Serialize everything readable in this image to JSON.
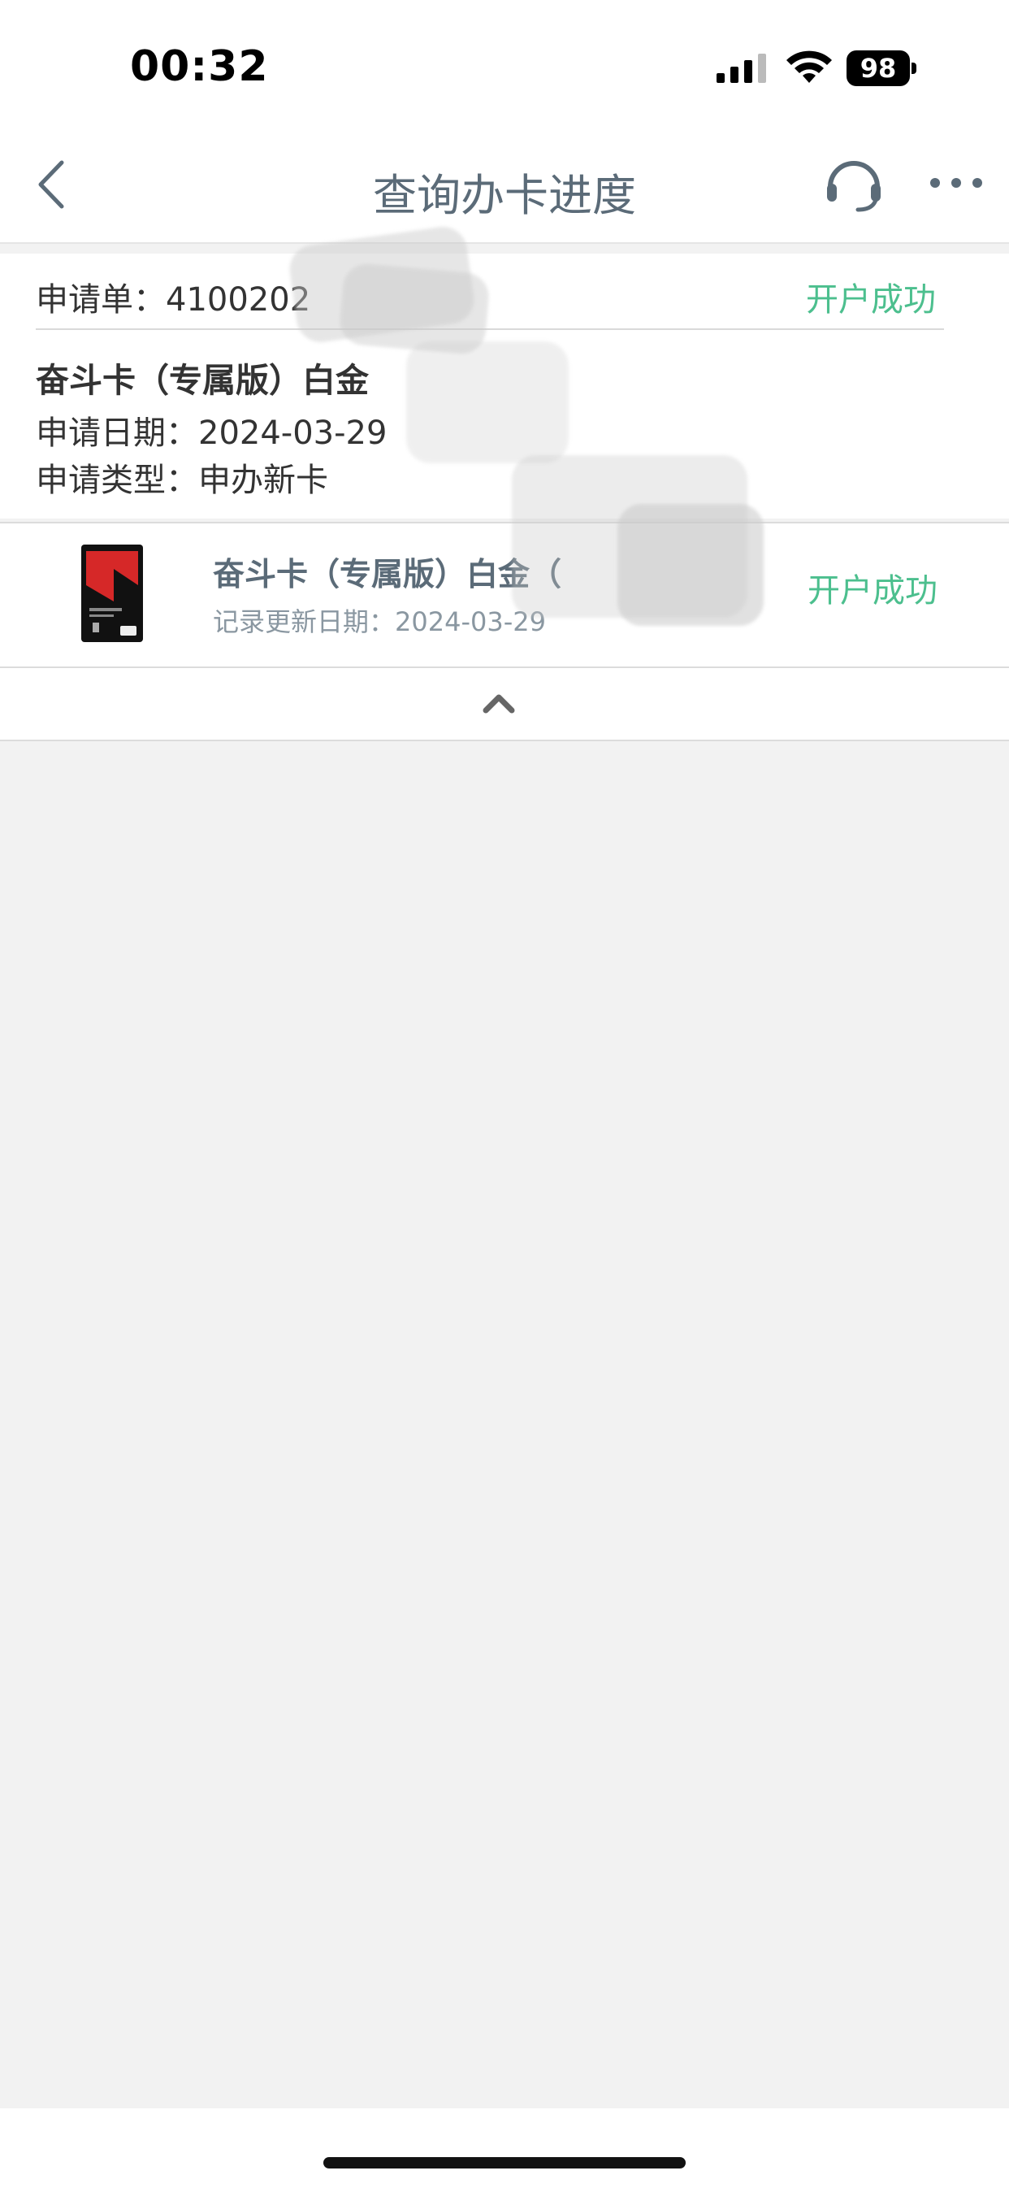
{
  "status_bar": {
    "time": "00:32",
    "battery": "98",
    "icons": [
      "cellular-signal-icon",
      "wifi-icon",
      "battery-icon"
    ]
  },
  "nav": {
    "title": "查询办卡进度",
    "icons": [
      "back-chevron-icon",
      "headset-service-icon",
      "more-dots-icon"
    ]
  },
  "application": {
    "number_label": "申请单：4100202",
    "status": "开户成功",
    "product_title": "奋斗卡（专属版）白金",
    "apply_date": "申请日期：2024-03-29",
    "apply_type": "申请类型：申办新卡"
  },
  "card_item": {
    "name": "奋斗卡（专属版）白金（",
    "update_date": "记录更新日期：2024-03-29",
    "status": "开户成功"
  },
  "colors": {
    "accent_green": "#4cbf8e",
    "nav_text": "#5b6b78",
    "page_background": "#f2f2f2"
  }
}
